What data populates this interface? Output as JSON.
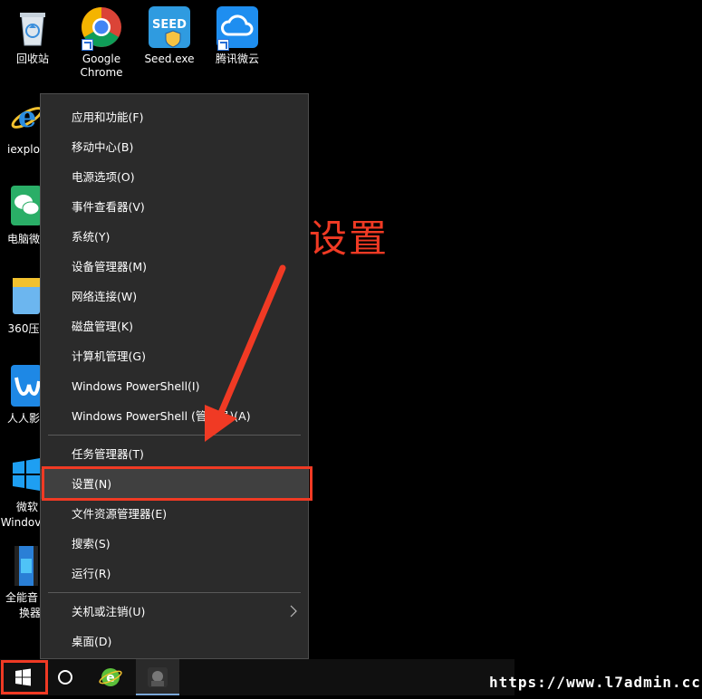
{
  "desktop": {
    "icons": [
      {
        "label": "回收站"
      },
      {
        "label": "Google Chrome"
      },
      {
        "label": "Seed.exe"
      },
      {
        "label": "腾讯微云"
      },
      {
        "label": "iexplo"
      },
      {
        "label": "电脑微"
      },
      {
        "label": "360压"
      },
      {
        "label": "人人影"
      },
      {
        "label": "微软"
      },
      {
        "label": "Windov"
      },
      {
        "label": "全能音"
      },
      {
        "label": "换器"
      }
    ]
  },
  "context_menu": {
    "items": [
      "应用和功能(F)",
      "移动中心(B)",
      "电源选项(O)",
      "事件查看器(V)",
      "系统(Y)",
      "设备管理器(M)",
      "网络连接(W)",
      "磁盘管理(K)",
      "计算机管理(G)",
      "Windows PowerShell(I)",
      "Windows PowerShell (管理员)(A)",
      "任务管理器(T)",
      "设置(N)",
      "文件资源管理器(E)",
      "搜索(S)",
      "运行(R)",
      "关机或注销(U)",
      "桌面(D)"
    ],
    "selected": "设置(N)"
  },
  "annotation": {
    "text": "设置"
  },
  "watermark": {
    "text": "https://www.l7admin.cc"
  },
  "colors": {
    "accent_red": "#f03a24",
    "menu_bg": "#2b2b2b",
    "highlight": "#404040"
  }
}
